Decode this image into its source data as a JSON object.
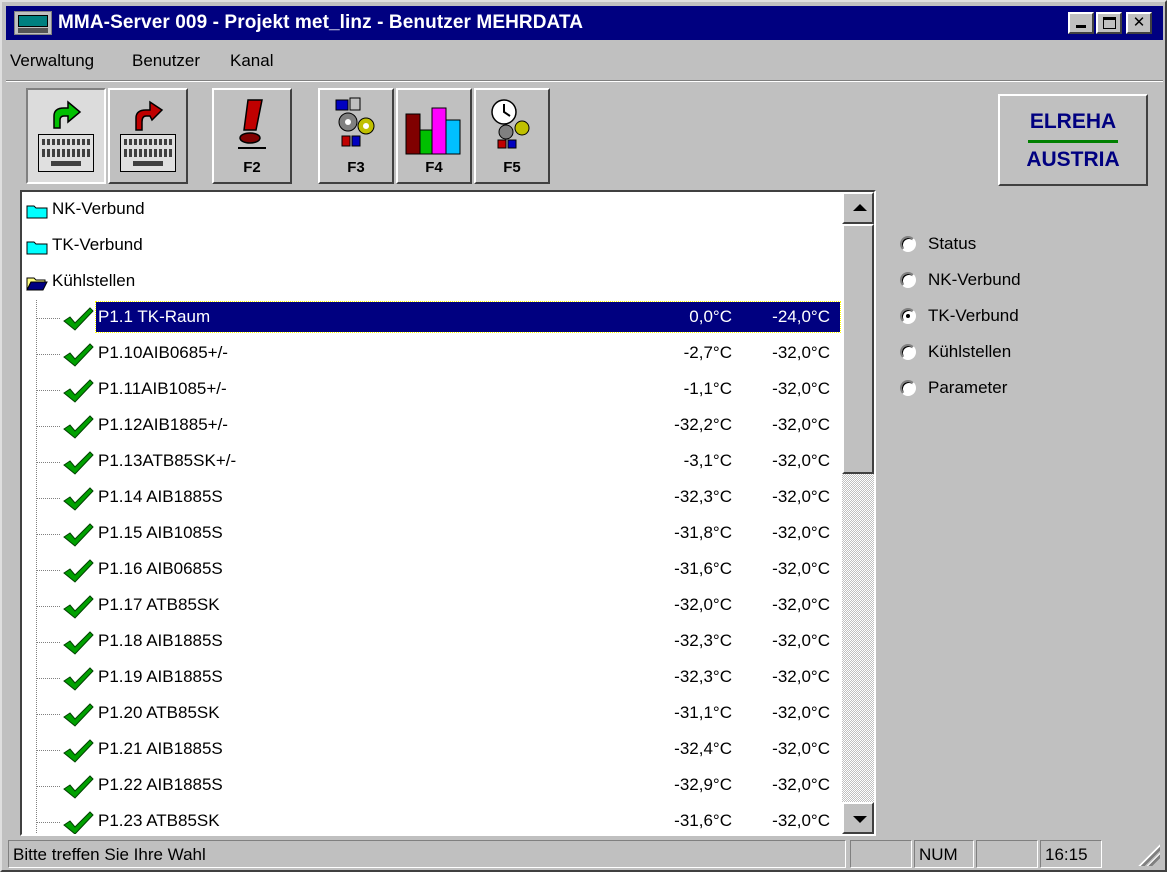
{
  "window": {
    "title": "MMA-Server 009 - Projekt met_linz - Benutzer MEHRDATA",
    "controls": {
      "minimize": "_",
      "maximize": "□",
      "close": "✕"
    }
  },
  "menu": {
    "items": [
      "Verwaltung",
      "Benutzer",
      "Kanal"
    ]
  },
  "toolbar": {
    "buttons": [
      {
        "name": "login",
        "icon": "keyboard-login-icon",
        "key": "",
        "pressed": true
      },
      {
        "name": "logout",
        "icon": "keyboard-logout-icon",
        "key": ""
      },
      {
        "name": "f2",
        "icon": "eraser-icon",
        "key": "F2"
      },
      {
        "name": "f3",
        "icon": "network-settings-icon",
        "key": "F3"
      },
      {
        "name": "f4",
        "icon": "bar-chart-icon",
        "key": "F4"
      },
      {
        "name": "f5",
        "icon": "clock-settings-icon",
        "key": "F5"
      }
    ],
    "logo": {
      "top": "ELREHA",
      "bottom": "AUSTRIA"
    }
  },
  "tree": {
    "folders": [
      {
        "label": "NK-Verbund",
        "open": false
      },
      {
        "label": "TK-Verbund",
        "open": false
      },
      {
        "label": "Kühlstellen",
        "open": true
      }
    ],
    "items": [
      {
        "label": "P1.1 TK-Raum",
        "actual": "0,0°C",
        "setpoint": "-24,0°C",
        "selected": true
      },
      {
        "label": "P1.10AIB0685+/-",
        "actual": "-2,7°C",
        "setpoint": "-32,0°C"
      },
      {
        "label": "P1.11AIB1085+/-",
        "actual": "-1,1°C",
        "setpoint": "-32,0°C"
      },
      {
        "label": "P1.12AIB1885+/-",
        "actual": "-32,2°C",
        "setpoint": "-32,0°C"
      },
      {
        "label": "P1.13ATB85SK+/-",
        "actual": "-3,1°C",
        "setpoint": "-32,0°C"
      },
      {
        "label": "P1.14 AIB1885S",
        "actual": "-32,3°C",
        "setpoint": "-32,0°C"
      },
      {
        "label": "P1.15 AIB1085S",
        "actual": "-31,8°C",
        "setpoint": "-32,0°C"
      },
      {
        "label": "P1.16 AIB0685S",
        "actual": "-31,6°C",
        "setpoint": "-32,0°C"
      },
      {
        "label": "P1.17 ATB85SK",
        "actual": "-32,0°C",
        "setpoint": "-32,0°C"
      },
      {
        "label": "P1.18 AIB1885S",
        "actual": "-32,3°C",
        "setpoint": "-32,0°C"
      },
      {
        "label": "P1.19 AIB1885S",
        "actual": "-32,3°C",
        "setpoint": "-32,0°C"
      },
      {
        "label": "P1.20 ATB85SK",
        "actual": "-31,1°C",
        "setpoint": "-32,0°C"
      },
      {
        "label": "P1.21 AIB1885S",
        "actual": "-32,4°C",
        "setpoint": "-32,0°C"
      },
      {
        "label": "P1.22 AIB1885S",
        "actual": "-32,9°C",
        "setpoint": "-32,0°C"
      },
      {
        "label": "P1.23 ATB85SK",
        "actual": "-31,6°C",
        "setpoint": "-32,0°C"
      }
    ]
  },
  "radios": {
    "options": [
      "Status",
      "NK-Verbund",
      "TK-Verbund",
      "Kühlstellen",
      "Parameter"
    ],
    "selected": "TK-Verbund"
  },
  "statusbar": {
    "message": "Bitte treffen Sie Ihre Wahl",
    "field2": "",
    "num": "NUM",
    "field4": "",
    "time": "16:15"
  },
  "colors": {
    "titlebar": "#000080",
    "selection": "#000080",
    "folder": "#00ffff",
    "check": "#00a000",
    "logo_text": "#000080",
    "logo_line": "#008000"
  }
}
